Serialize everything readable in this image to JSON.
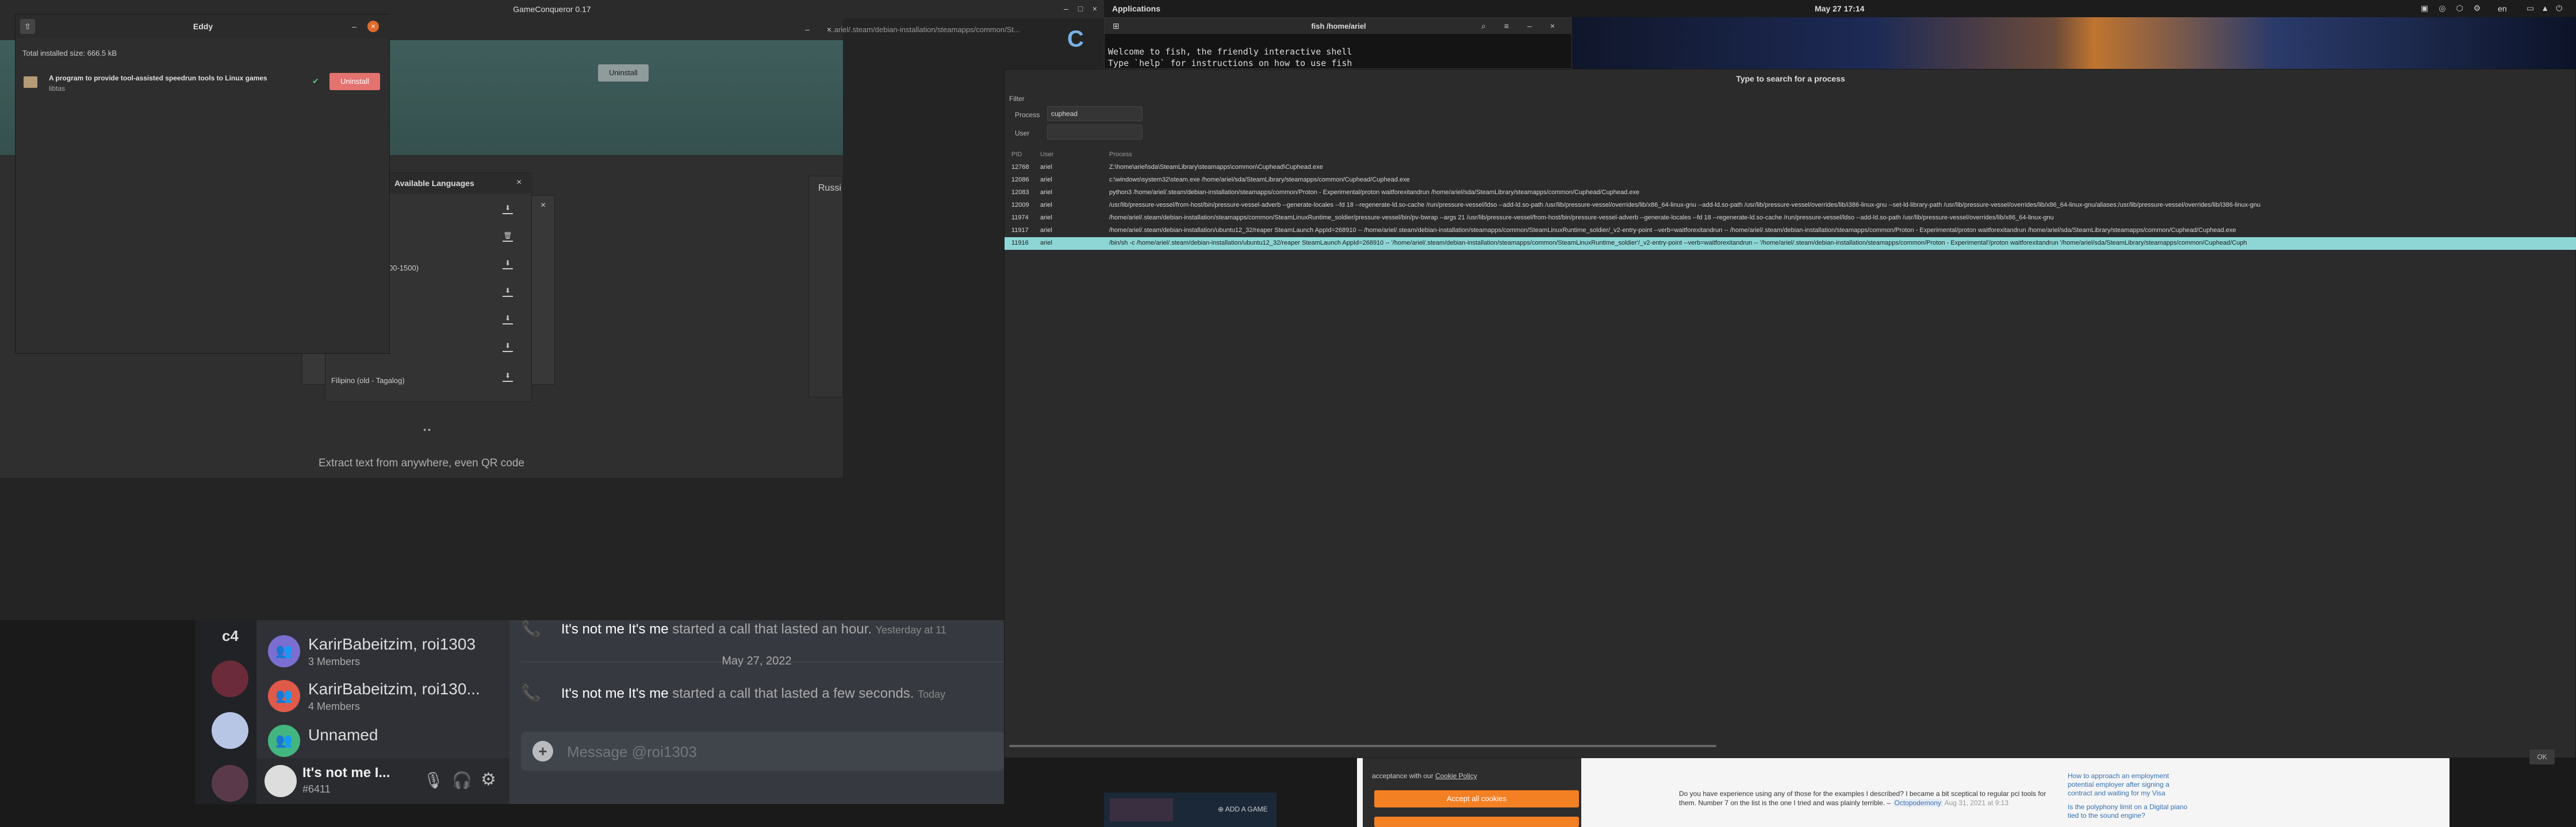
{
  "topbar": {
    "applications": "Applications",
    "clock": "May 27  17:14",
    "lang": "en"
  },
  "gameconqueror": {
    "title": "GameConqueror 0.17",
    "path_fragment": "...ariel/.steam/debian-installation/steamapps/common/St...",
    "uninstall_label": "Uninstall",
    "extract_text": "Extract text from anywhere, even QR code"
  },
  "eddy": {
    "title": "Eddy",
    "installed_size": "Total installed size: 666.5 kB",
    "package_desc": "A program to provide tool-assisted speedrun tools to Linux games",
    "package_name": "libtas",
    "uninstall_btn": "Uninstall"
  },
  "languages": {
    "title": "Available Languages",
    "partial_item": "00-1500)",
    "last_item": "Filipino (old - Tagalog)",
    "right_fragment": "Russi"
  },
  "terminal": {
    "title": "fish /home/ariel",
    "line1": "Welcome to fish, the friendly interactive shell",
    "line2": "Type `help` for instructions on how to use fish"
  },
  "process_dialog": {
    "header": "Type to search for a process",
    "filter_label": "Filter",
    "process_label": "Process",
    "process_value": "cuphead",
    "user_label": "User",
    "col_pid": "PID",
    "col_user": "User",
    "col_process": "Process",
    "ok_label": "OK",
    "rows": [
      {
        "pid": "12768",
        "user": "ariel",
        "cmd": "Z:\\home\\ariel\\sda\\SteamLibrary\\steamapps\\common\\Cuphead\\Cuphead.exe"
      },
      {
        "pid": "12086",
        "user": "ariel",
        "cmd": "c:\\windows\\system32\\steam.exe /home/ariel/sda/SteamLibrary/steamapps/common/Cuphead/Cuphead.exe"
      },
      {
        "pid": "12083",
        "user": "ariel",
        "cmd": "python3 /home/ariel/.steam/debian-installation/steamapps/common/Proton - Experimental/proton waitforexitandrun /home/ariel/sda/SteamLibrary/steamapps/common/Cuphead/Cuphead.exe"
      },
      {
        "pid": "12009",
        "user": "ariel",
        "cmd": "/usr/lib/pressure-vessel/from-host/bin/pressure-vessel-adverb --generate-locales --fd 18 --regenerate-ld.so-cache /run/pressure-vessel/ldso --add-ld.so-path /usr/lib/pressure-vessel/overrides/lib/x86_64-linux-gnu --add-ld.so-path /usr/lib/pressure-vessel/overrides/lib/i386-linux-gnu --set-ld-library-path /usr/lib/pressure-vessel/overrides/lib/x86_64-linux-gnu/aliases:/usr/lib/pressure-vessel/overrides/lib/i386-linux-gnu"
      },
      {
        "pid": "11974",
        "user": "ariel",
        "cmd": "/home/ariel/.steam/debian-installation/steamapps/common/SteamLinuxRuntime_soldier/pressure-vessel/bin/pv-bwrap --args 21 /usr/lib/pressure-vessel/from-host/bin/pressure-vessel-adverb --generate-locales --fd 18 --regenerate-ld.so-cache /run/pressure-vessel/ldso --add-ld.so-path /usr/lib/pressure-vessel/overrides/lib/x86_64-linux-gnu"
      },
      {
        "pid": "11917",
        "user": "ariel",
        "cmd": "/home/ariel/.steam/debian-installation/ubuntu12_32/reaper SteamLaunch AppId=268910 -- /home/ariel/.steam/debian-installation/steamapps/common/SteamLinuxRuntime_soldier/_v2-entry-point --verb=waitforexitandrun -- /home/ariel/.steam/debian-installation/steamapps/common/Proton - Experimental/proton waitforexitandrun /home/ariel/sda/SteamLibrary/steamapps/common/Cuphead/Cuphead.exe"
      },
      {
        "pid": "11916",
        "user": "ariel",
        "cmd": "/bin/sh -c /home/ariel/.steam/debian-installation/ubuntu12_32/reaper SteamLaunch AppId=268910 -- '/home/ariel/.steam/debian-installation/steamapps/common/SteamLinuxRuntime_soldier'/_v2-entry-point --verb=waitforexitandrun -- '/home/ariel/.steam/debian-installation/steamapps/common/Proton - Experimental'/proton waitforexitandrun '/home/ariel/sda/SteamLibrary/steamapps/common/Cuphead/Cuph"
      }
    ]
  },
  "discord": {
    "server_label": "c4",
    "channels": [
      {
        "name": "KarirBabeitzim, roi1303",
        "sub": "3 Members"
      },
      {
        "name": "KarirBabeitzim, roi130...",
        "sub": "4 Members"
      },
      {
        "name": "Unnamed",
        "sub": ""
      }
    ],
    "user_name": "It's not me I...",
    "user_tag": "#6411",
    "msg1_name": "It's not me It's me",
    "msg1_text": " started a call that lasted an hour.",
    "msg1_time": "Yesterday at 11",
    "date_divider": "May 27, 2022",
    "msg2_name": "It's not me It's me",
    "msg2_text": " started a call that lasted a few seconds.",
    "msg2_time": "Today",
    "input_placeholder": "Message @roi1303"
  },
  "browser": {
    "cookie_policy_text": "acceptance with our",
    "cookie_policy_link": "Cookie Policy",
    "accept_btn": "Accept all cookies",
    "post_text": "Do you have experience using any of those for the examples I described? I became a bit sceptical to regular pci tools for them. Number 7 on the list is the one I tried and was plainly terrible. –",
    "post_user": "Octopodemony",
    "post_date": "Aug 31, 2021 at 9:13",
    "side_q1": "How to approach an employment potential employer after signing a contract and waiting for my Visa",
    "side_q2": "Is the polyphony limit on a Digital piano tied to the sound engine?",
    "add_game": "ADD A GAME"
  }
}
